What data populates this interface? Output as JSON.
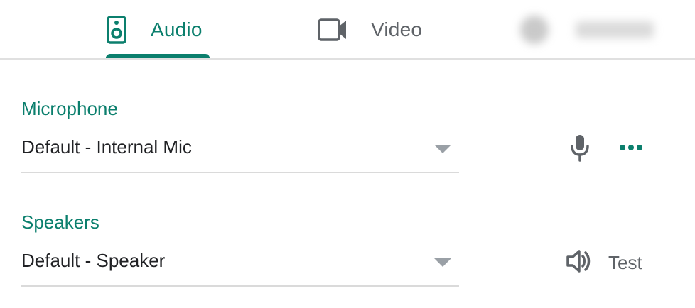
{
  "colors": {
    "accent": "#0b7f6d",
    "icon_gray": "#5f6368",
    "text_dark": "#202124",
    "text_gray": "#5f6368",
    "divider": "#dadada"
  },
  "tabs": [
    {
      "label": "Audio",
      "icon": "speaker-device-icon",
      "selected": true
    },
    {
      "label": "Video",
      "icon": "videocam-icon",
      "selected": false
    }
  ],
  "microphone": {
    "label": "Microphone",
    "selected_value": "Default - Internal Mic",
    "mic_icon": "mic-icon",
    "more_icon": "more-horiz-icon"
  },
  "speakers": {
    "label": "Speakers",
    "selected_value": "Default - Speaker",
    "test_icon": "volume-icon",
    "test_label": "Test"
  }
}
